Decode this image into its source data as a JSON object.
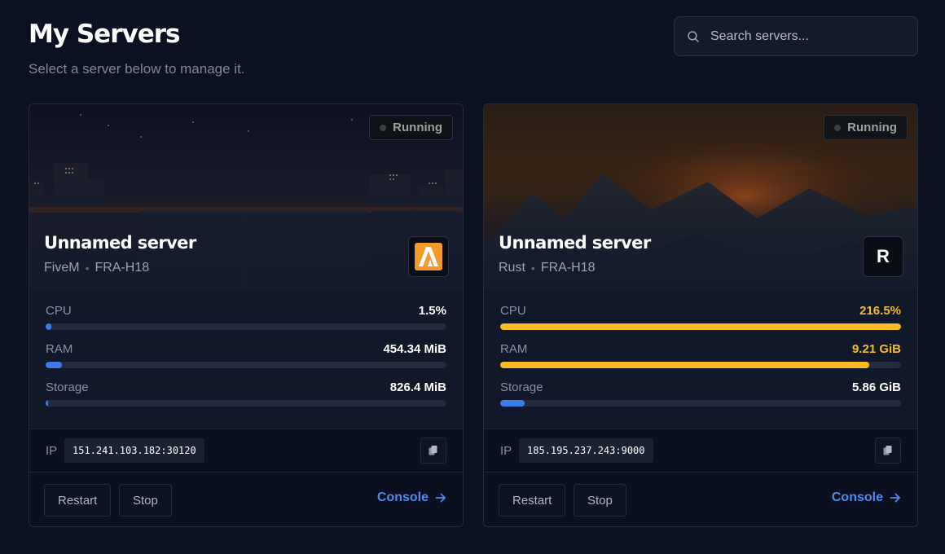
{
  "header": {
    "title": "My Servers",
    "subtitle": "Select a server below to manage it."
  },
  "search": {
    "placeholder": "Search servers...",
    "icon": "search-icon"
  },
  "servers": [
    {
      "status": "Running",
      "name": "Unnamed server",
      "game": "FiveM",
      "location": "FRA-H18",
      "game_icon": "fivem-logo-icon",
      "stats": [
        {
          "label": "CPU",
          "value": "1.5%",
          "level_pct": 1.5,
          "warn": false
        },
        {
          "label": "RAM",
          "value": "454.34 MiB",
          "level_pct": 4,
          "warn": false
        },
        {
          "label": "Storage",
          "value": "826.4 MiB",
          "level_pct": 0.6,
          "warn": false
        }
      ],
      "ip_label": "IP",
      "ip": "151.241.103.182:30120",
      "restart_label": "Restart",
      "stop_label": "Stop",
      "console_label": "Console"
    },
    {
      "status": "Running",
      "name": "Unnamed server",
      "game": "Rust",
      "location": "FRA-H18",
      "game_icon_letter": "R",
      "stats": [
        {
          "label": "CPU",
          "value": "216.5%",
          "level_pct": 100,
          "warn": true
        },
        {
          "label": "RAM",
          "value": "9.21 GiB",
          "level_pct": 92,
          "warn": true
        },
        {
          "label": "Storage",
          "value": "5.86 GiB",
          "level_pct": 6,
          "warn": false
        }
      ],
      "ip_label": "IP",
      "ip": "185.195.237.243:9000",
      "restart_label": "Restart",
      "stop_label": "Stop",
      "console_label": "Console"
    }
  ],
  "colors": {
    "background": "#0c1122",
    "card": "#111829",
    "accent_blue": "#3e7ae8",
    "warn_yellow": "#fbbd23",
    "link_blue": "#4d8af0"
  }
}
